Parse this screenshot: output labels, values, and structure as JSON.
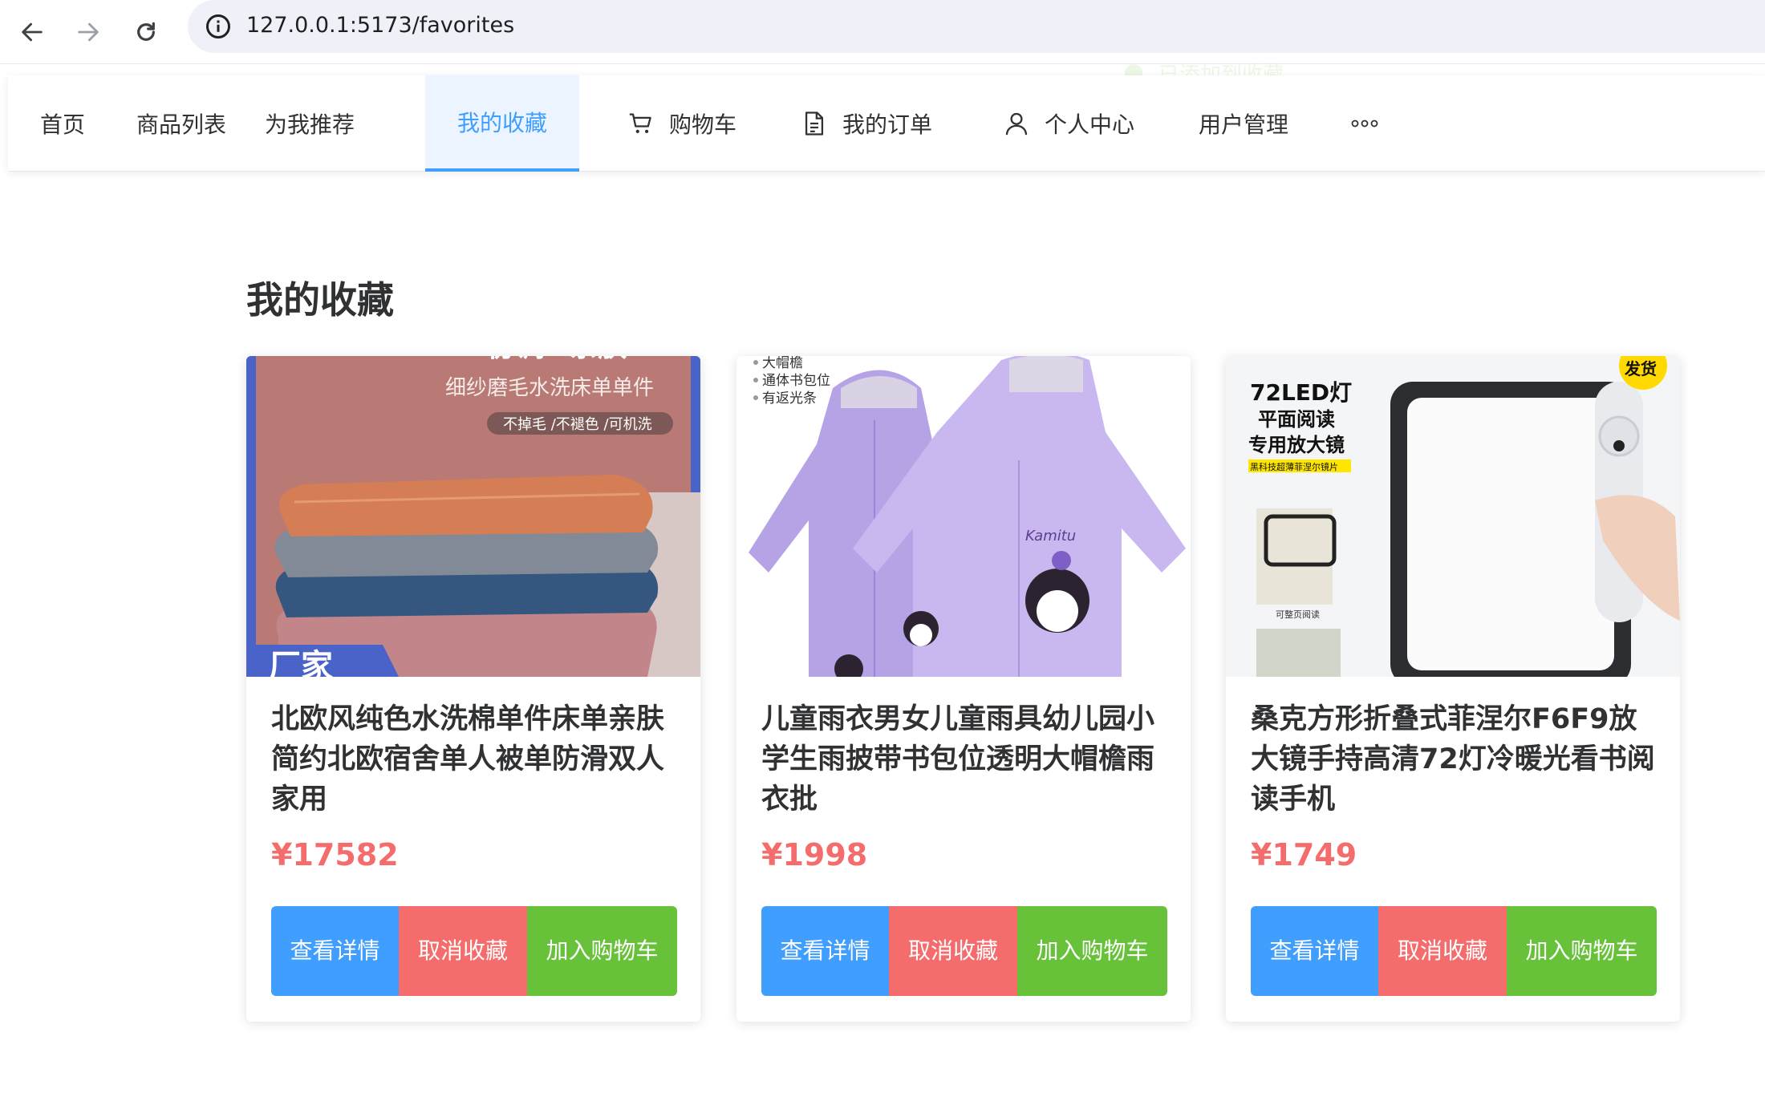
{
  "browser": {
    "url": "127.0.0.1:5173/favorites",
    "back_icon": "arrow-left-icon",
    "forward_icon": "arrow-right-icon",
    "reload_icon": "reload-icon",
    "info_icon": "info-icon"
  },
  "menu": {
    "items": [
      {
        "label": "首页"
      },
      {
        "label": "商品列表"
      },
      {
        "label": "为我推荐"
      },
      {
        "label": "我的收藏",
        "active": true
      },
      {
        "label": "购物车",
        "icon": "cart-icon"
      },
      {
        "label": "我的订单",
        "icon": "document-icon"
      },
      {
        "label": "个人中心",
        "icon": "user-icon"
      },
      {
        "label": "用户管理"
      }
    ],
    "more_icon": "more-icon"
  },
  "toast": {
    "text": "已添加到收藏"
  },
  "page": {
    "title": "我的收藏"
  },
  "products": [
    {
      "title": "北欧风纯色水洗棉单件床单亲肤简约北欧宿舍单人被单防滑双人家用",
      "price": "¥17582",
      "image_text": {
        "line1": "协调+亲肤",
        "line2": "细纱磨毛水洗床单单件",
        "tag": "不掉毛 /不褪色 /可机洗",
        "corner": "厂家"
      }
    },
    {
      "title": "儿童雨衣男女儿童雨具幼儿园小学生雨披带书包位透明大帽檐雨衣批",
      "price": "¥1998",
      "image_text": {
        "bullet1": "大帽檐",
        "bullet2": "通体书包位",
        "bullet3": "有返光条",
        "brand": "Kamitu"
      }
    },
    {
      "title": "桑克方形折叠式菲涅尔F6F9放大镜手持高清72灯冷暖光看书阅读手机",
      "price": "¥1749",
      "image_text": {
        "line1": "72LED灯",
        "line2": "平面阅读",
        "line3": "专用放大镜",
        "tag": "黑科技超薄菲涅尔镜片",
        "caption": "可整页阅读",
        "badge": "发货"
      }
    }
  ],
  "buttons": {
    "detail": "查看详情",
    "cancel": "取消收藏",
    "cart": "加入购物车"
  },
  "colors": {
    "primary": "#409eff",
    "danger": "#f56c6c",
    "success": "#67c23a",
    "price": "#f56c6c"
  }
}
